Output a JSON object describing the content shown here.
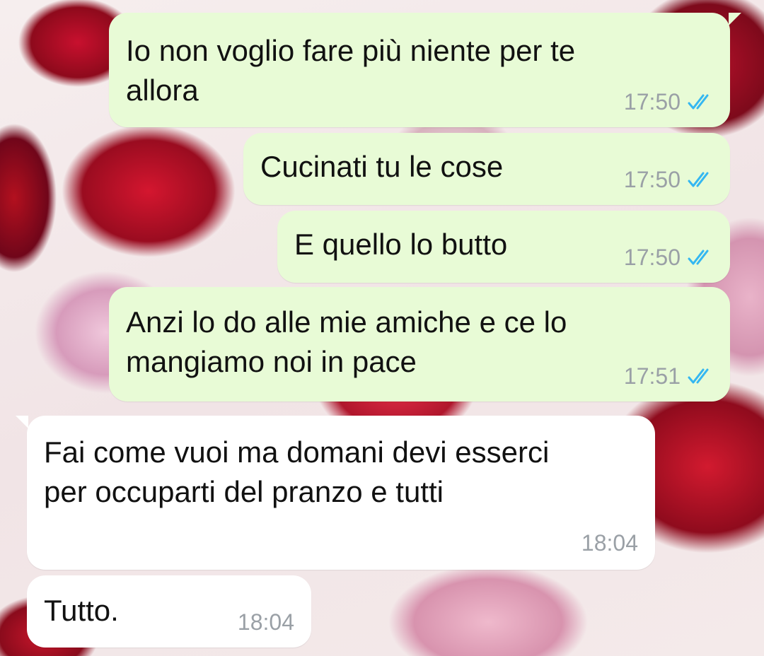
{
  "messages": [
    {
      "direction": "outgoing",
      "lines": [
        "Io non voglio fare più niente per te",
        "allora"
      ],
      "time": "17:50",
      "status": "read-ticks-icon"
    },
    {
      "direction": "outgoing",
      "lines": [
        "Cucinati tu le cose"
      ],
      "time": "17:50",
      "status": "read-ticks-icon"
    },
    {
      "direction": "outgoing",
      "lines": [
        "E quello lo butto"
      ],
      "time": "17:50",
      "status": "read-ticks-icon"
    },
    {
      "direction": "outgoing",
      "lines": [
        "Anzi lo do alle mie amiche e ce lo",
        "mangiamo noi in pace"
      ],
      "time": "17:51",
      "status": "read-ticks-icon"
    },
    {
      "direction": "incoming",
      "lines": [
        "Fai come vuoi ma domani devi esserci",
        "per occuparti del pranzo e tutti"
      ],
      "time": "18:04"
    },
    {
      "direction": "incoming",
      "lines": [
        "Tutto."
      ],
      "time": "18:04"
    }
  ],
  "colors": {
    "outgoing_bubble": "#e8fbd6",
    "incoming_bubble": "#ffffff",
    "read_ticks": "#34b7f1",
    "timestamp": "#9aa0a6"
  }
}
